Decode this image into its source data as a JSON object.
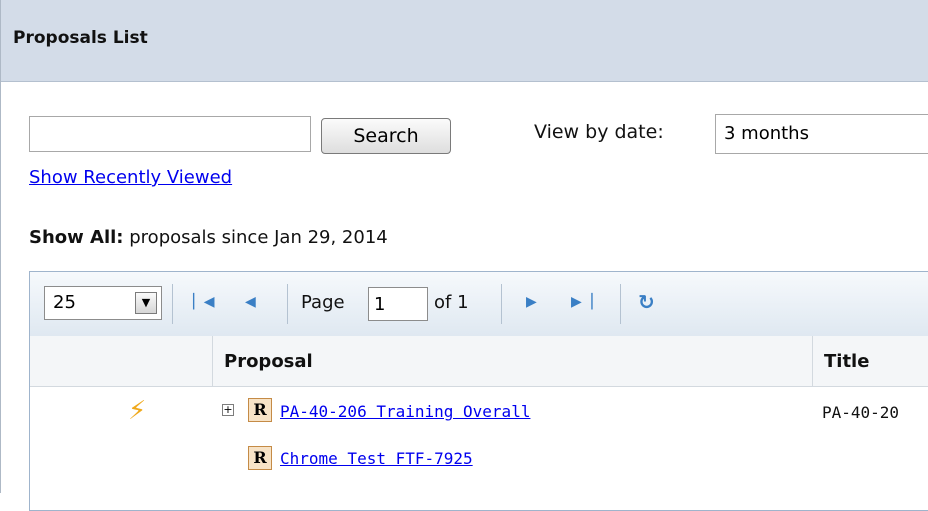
{
  "header": {
    "title": "Proposals List"
  },
  "search": {
    "value": "",
    "button_label": "Search",
    "recent_link": "Show Recently Viewed"
  },
  "view_by_date": {
    "label": "View by date:",
    "selected": "3 months"
  },
  "show_all": {
    "label": "Show All:",
    "text": "proposals since Jan 29, 2014"
  },
  "toolbar": {
    "page_size": "25",
    "page_label": "Page",
    "page_value": "1",
    "of_label": "of 1",
    "icons": [
      "first-page-icon",
      "prev-page-icon",
      "next-page-icon",
      "last-page-icon",
      "refresh-icon"
    ]
  },
  "grid": {
    "columns": [
      "",
      "Proposal",
      "Title"
    ],
    "rows": [
      {
        "icon": "lightning-icon",
        "expandable": true,
        "badge": "R",
        "proposal": "PA-40-206 Training Overall",
        "title": "PA-40-20"
      },
      {
        "icon": "",
        "expandable": false,
        "badge": "R",
        "proposal": "Chrome Test FTF-7925",
        "title": ""
      }
    ]
  },
  "colors": {
    "header_bg": "#d3dce8",
    "link": "#0000ee",
    "nav_icons": "#3a7fc5",
    "bolt": "#f0a91b",
    "badge_bg": "#f7e3c7"
  }
}
